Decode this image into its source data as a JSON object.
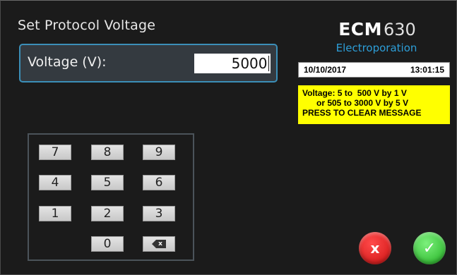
{
  "header": {
    "title": "Set Protocol Voltage"
  },
  "voltage": {
    "label": "Voltage (V):",
    "value": "5000"
  },
  "brand": {
    "name": "ECM",
    "model": "630",
    "subtitle": "Electroporation",
    "accent_color": "#2d9ed8"
  },
  "status": {
    "date": "10/10/2017",
    "time": "13:01:15"
  },
  "message": {
    "line1": "Voltage: 5 to  500 V by 1 V",
    "line2": "or 505 to 3000 V by 5 V",
    "line3": "PRESS TO CLEAR MESSAGE",
    "background": "#ffff00"
  },
  "keypad": {
    "keys": [
      "7",
      "8",
      "9",
      "4",
      "5",
      "6",
      "1",
      "2",
      "3",
      "0"
    ],
    "backspace_icon": "backspace-icon",
    "backspace_glyph": "x"
  },
  "actions": {
    "cancel_glyph": "x",
    "cancel_color": "#e01f1f",
    "confirm_glyph": "✓",
    "confirm_color": "#2cc62c"
  }
}
